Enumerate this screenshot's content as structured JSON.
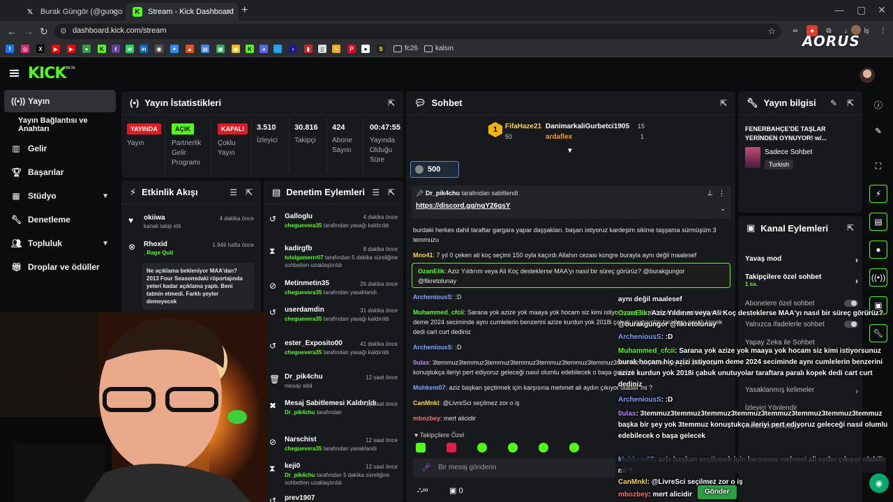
{
  "browser": {
    "tabs": [
      {
        "label": "Burak Güngör (@gungorburak)",
        "icon": "x-icon"
      },
      {
        "label": "Stream - Kick Dashboard",
        "icon": "kick-icon"
      }
    ],
    "url_host": "dashboard.kick.com",
    "url_path": "/stream",
    "url_full": "dashboard.kick.com/stream",
    "profile_label": "İş",
    "bookmarks": {
      "folder1": "fc26",
      "folder2": "kalsın"
    },
    "brand_overlay": "AORUS"
  },
  "kick": {
    "logo": "KICK",
    "beta": "BETA"
  },
  "nav": {
    "items": [
      {
        "label": "Yayın",
        "icon": "broadcast-icon"
      },
      {
        "label": "Yayın Bağlantısı ve Anahtarı",
        "icon": ""
      },
      {
        "label": "Gelir",
        "icon": "chart-icon"
      },
      {
        "label": "Başarılar",
        "icon": "trophy-icon"
      },
      {
        "label": "Stüdyo",
        "icon": "grid-icon"
      },
      {
        "label": "Denetleme",
        "icon": "wrench-icon"
      },
      {
        "label": "Topluluk",
        "icon": "people-icon"
      },
      {
        "label": "Droplar ve ödüller",
        "icon": "gift-icon"
      }
    ]
  },
  "stats": {
    "title": "Yayın İstatistikleri",
    "live_badge": "YAYINDA",
    "live_label": "Yayın",
    "partner_badge": "AÇIK",
    "partner_label1": "Partnerlik",
    "partner_label2": "Gelir",
    "partner_label3": "Programı",
    "multi_badge": "KAPALI",
    "multi_label1": "Çoklu",
    "multi_label2": "Yayın",
    "viewers": "3.510",
    "viewers_label": "İzleyici",
    "followers": "30.816",
    "followers_label": "Takipçi",
    "subs": "424",
    "subs_label1": "Abone",
    "subs_label2": "Sayısı",
    "uptime": "00:47:55",
    "uptime_label1": "Yayında",
    "uptime_label2": "Olduğu",
    "uptime_label3": "Süre"
  },
  "activity": {
    "title": "Etkinlik Akışı",
    "items": [
      {
        "name": "okiiwa",
        "sub": "kanalı takip etti",
        "time": "4 dakika önce"
      },
      {
        "name": "Rhoxid",
        "sub_green": "Rage Quit",
        "time": "1.946 hafta önce"
      }
    ],
    "quote": "Ne açıklama bekleniyor MAA'dan? 2013 Four Seasonsdaki röportajında yeteri kadar açıklama yaptı. Beni tatmin etmedi. Farklı şeyler demeyecek"
  },
  "moderation": {
    "title": "Denetim Eylemleri",
    "items": [
      {
        "name": "Galloglu",
        "actor": "cheguevera35",
        "sub": "tarafından yasağı kaldırıldı",
        "time": "4 dakika önce"
      },
      {
        "name": "kadirgfb",
        "actor": "tvlolgamerrr07",
        "sub": "tarafından 5 dakika süreliğine sohbetten uzaklaştırıldı",
        "time": "8 dakika önce"
      },
      {
        "name": "Metinmetin35",
        "actor": "cheguevera35",
        "sub": "tarafından yasaklandı",
        "time": "26 dakika önce"
      },
      {
        "name": "userdamdin",
        "actor": "cheguevera35",
        "sub": "tarafından yasağı kaldırıldı",
        "time": "31 dakika önce"
      },
      {
        "name": "ester_Exposito00",
        "actor": "cheguevera35",
        "sub": "tarafından yasağı kaldırıldı",
        "time": "41 dakika önce"
      },
      {
        "name": "Dr_pik4chu",
        "actor": "",
        "sub": "mesajı sildi",
        "time": "12 saat önce"
      },
      {
        "name": "Mesaj Sabitlemesi Kaldırıldı",
        "actor": "Dr_pik4chu",
        "sub": "tarafından",
        "time": "12 saat önce"
      },
      {
        "name": "Narschist",
        "actor": "cheguevera35",
        "sub": "tarafından yasaklandı",
        "time": "12 saat önce"
      },
      {
        "name": "keji0",
        "actor": "Dr_pik4chu",
        "sub": "tarafından 5 dakika süreliğine sohbetten uzaklaştırıldı",
        "time": "12 saat önce"
      },
      {
        "name": "prev1907",
        "actor": "",
        "sub": "",
        "time": ""
      }
    ]
  },
  "chat": {
    "title": "Sohbet",
    "top1_name": "FifaHaze21",
    "top1_val": "50",
    "top2_name": "DanimarkaliGurbetci1905",
    "top2_val": "15",
    "top3_name": "ardaflex",
    "top3_val": "1",
    "kicks": "500",
    "pinned_by": "Dr_pik4chu",
    "pinned_label": "tarafından sabitlendi",
    "pinned_link": "https://discord.gg/ngY26gsY",
    "messages": [
      {
        "user": "",
        "text": "burdaki herkes dahil taraftar gargara yapar daşşakları. başarı istiyoruz kardeşim sikime taşşama sürmüşüm 3 temmuzu",
        "color": "#e5e5e5"
      },
      {
        "user": "Mno41",
        "text": ": 7 yıl 0 çeken ali koç seçimi 150 oyla kaçırdı Allahın cezası kongre burayla aynı değil maalesef",
        "color": "#fcd34d"
      },
      {
        "user": "ArcheniousS",
        "text": ": :D",
        "color": "#7aa7ff"
      },
      {
        "user": "Muhammed_cfcii",
        "text": ": Sarana yok azize yok maaya yok hocam siz kimi istiyorsunuz burak hocam hiç azizi istiyorum deme 2024 seciminde aynı cumlelerin benzerini azize kurdun yok 2018i çabuk unutuyolar taraftara paralı kopek dedi cart curt dediniz",
        "color": "#53fc18"
      },
      {
        "user": "ArcheniousS",
        "text": ": :D",
        "color": "#7aa7ff"
      },
      {
        "user": "0ulas",
        "text": ": 3temmuz3temmuz3temmuz3temmuz3temmuz3temmuz3temmuz3temmuz başka bir şey yok 3temmuz konuştukça ileriyi pert ediyoruz geleceği nasıl olumlu edebilecek o başa gelecek",
        "color": "#c084fc"
      },
      {
        "user": "Mohkem07",
        "text": ": aziz başkan şeçtirmek için karşısına mehmet ali aydın çıkıyor olabilir mi ?",
        "color": "#7aa7ff"
      },
      {
        "user": "CanMnkl",
        "text": ": @LivreSci seçilmez zor o iş",
        "color": "#fcd34d"
      },
      {
        "user": "mbozbey",
        "text": ": mert alicidir",
        "color": "#f87171"
      }
    ],
    "highlight_user": "OzanElik",
    "highlight_text": ": Aziz Yıldırım veya Ali Koç desteklerse MAA'yı nasıl bir süreç görürüz? @burakgungor @fikretolunay",
    "followers_only": "Takipçilere Özel",
    "placeholder": "Bir mesaj gönderin",
    "send": "Gönder",
    "counter": "0"
  },
  "overlay": [
    {
      "user": "",
      "text": "aynı değil maalesef",
      "color": "#fff"
    },
    {
      "user": "OzanElik",
      "text": ": Aziz Yıldırım veya Ali Koç desteklerse MAA'yı nasıl bir süreç görürüz? @burakgungor @fikretolunay",
      "color": "#53fc18"
    },
    {
      "user": "ArcheniousS",
      "text": ": :D",
      "color": "#7aa7ff"
    },
    {
      "user": "Muhammed_cfcii",
      "text": ": Sarana yok azize yok maaya yok hocam siz kimi istiyorsunuz burak hocam hiç azizi istiyorum deme 2024 seciminde aynı cumlelerin benzerini azize kurdun yok 2018i çabuk unutuyolar taraftara paralı kopek dedi cart curt dediniz",
      "color": "#53fc18"
    },
    {
      "user": "ArcheniousS",
      "text": ": :D",
      "color": "#7aa7ff"
    },
    {
      "user": "0ulas",
      "text": ": 3temmuz3temmuz3temmuz3temmuz3temmuz3temmuz3temmuz3temmuz başka bir şey yok 3temmuz konuştukça ileriyi pert ediyoruz geleceği nasıl olumlu edebilecek o başa gelecek",
      "color": "#c084fc"
    },
    {
      "user": "Mohkem07",
      "text": ": aziz başkan şeçtirmek için karşısına mehmet ali aydın çıkıyor olabilir mi ?",
      "color": "#7aa7ff"
    },
    {
      "user": "CanMnkl",
      "text": ": @LivreSci seçilmez zor o iş",
      "color": "#fcd34d"
    },
    {
      "user": "mbozbey",
      "text": ": mert alicidir",
      "color": "#f87171"
    }
  ],
  "streaminfo": {
    "title": "Yayın bilgisi",
    "stream_title": "FENERBAHÇE'DE TAŞLAR YERİNDEN OYNUYOR! w/...",
    "category": "Sadece Sohbet",
    "language": "Turkish"
  },
  "channel_actions": {
    "title": "Kanal Eylemleri",
    "slow": "Yavaş mod",
    "followers_chat": "Takipçilere özel sohbet",
    "followers_chat_sub": "1 sa.",
    "subs_chat": "Abonelere özel sohbet",
    "emotes_only": "Yalnızca ifadelerle sohbet",
    "ai": "Yapay Zeka ile Sohbet",
    "banned_words": "Yasaklanmış kelimeler",
    "redirect": "İzleyici Yönlendir",
    "goal": "Hedefleri belirleyin"
  },
  "accent": "#53fc18"
}
